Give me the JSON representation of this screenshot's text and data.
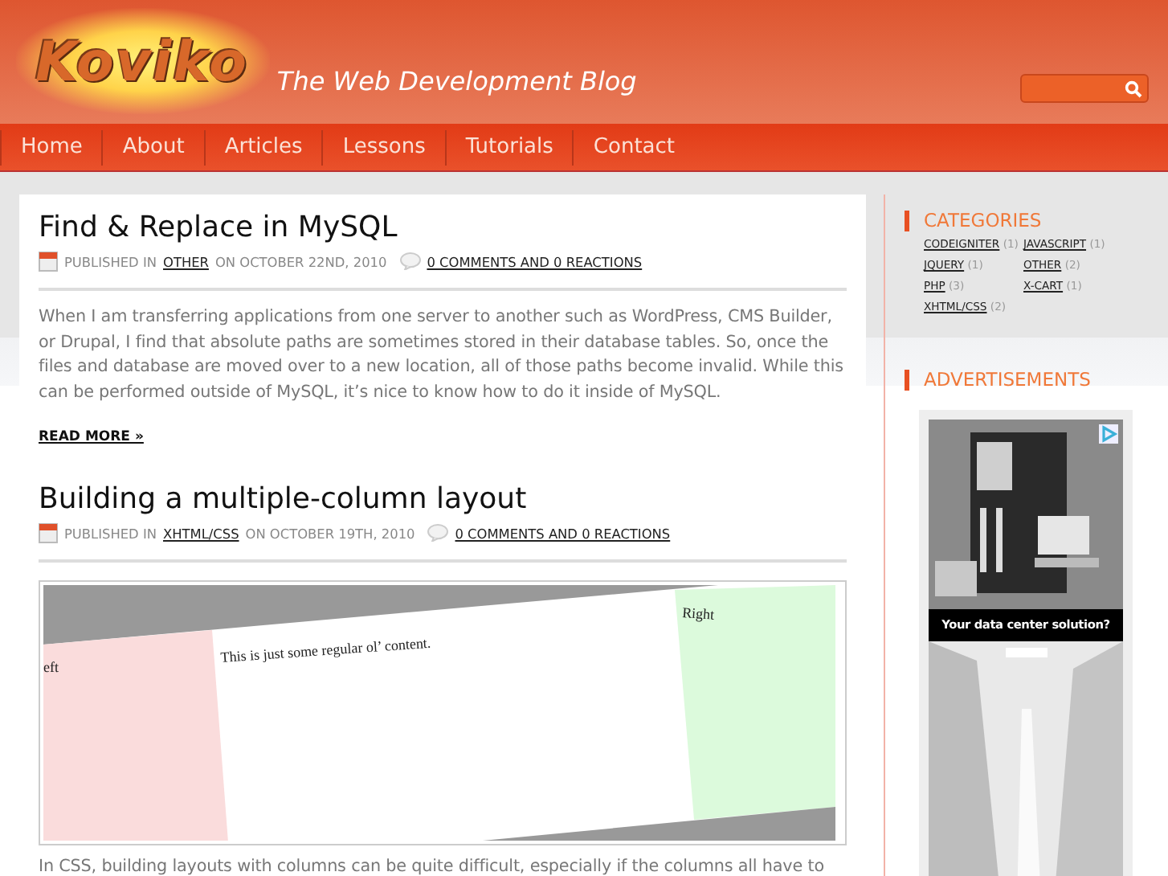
{
  "header": {
    "logo": "Koviko",
    "tagline": "The Web Development Blog"
  },
  "nav": [
    {
      "label": "Home"
    },
    {
      "label": "About"
    },
    {
      "label": "Articles"
    },
    {
      "label": "Lessons"
    },
    {
      "label": "Tutorials"
    },
    {
      "label": "Contact"
    }
  ],
  "posts": [
    {
      "title": "Find & Replace in MySQL",
      "published_label": "PUBLISHED IN",
      "category": "OTHER",
      "date_text": "ON OCTOBER 22ND, 2010",
      "comments": "0 COMMENTS AND 0 REACTIONS",
      "excerpt": "When I am transferring applications from one server to another such as WordPress, CMS Builder, or Drupal, I find that absolute paths are sometimes stored in their database tables. So, once the files and database are moved over to a new location, all of those paths become invalid. While this can be performed outside of MySQL, it’s nice to know how to do it inside of MySQL.",
      "read_more": "READ MORE »"
    },
    {
      "title": "Building a multiple-column layout",
      "published_label": "PUBLISHED IN",
      "category": "XHTML/CSS",
      "date_text": "ON OCTOBER 19TH, 2010",
      "comments": "0 COMMENTS AND 0 REACTIONS",
      "figure": {
        "left_text": "eft",
        "content_text": "This is just some regular ol’ content.",
        "right_text": "Right"
      },
      "excerpt": "In CSS, building layouts with columns can be quite difficult, especially if the columns all have to"
    }
  ],
  "sidebar": {
    "categories": {
      "title": "CATEGORIES",
      "items": [
        {
          "name": "CODEIGNITER",
          "count": "(1)"
        },
        {
          "name": "JAVASCRIPT",
          "count": "(1)"
        },
        {
          "name": "JQUERY",
          "count": "(1)"
        },
        {
          "name": "OTHER",
          "count": "(2)"
        },
        {
          "name": "PHP",
          "count": "(3)"
        },
        {
          "name": "X-CART",
          "count": "(1)"
        },
        {
          "name": "XHTML/CSS",
          "count": "(2)"
        }
      ]
    },
    "advertisements": {
      "title": "ADVERTISEMENTS",
      "caption": "Your data center solution?"
    }
  }
}
